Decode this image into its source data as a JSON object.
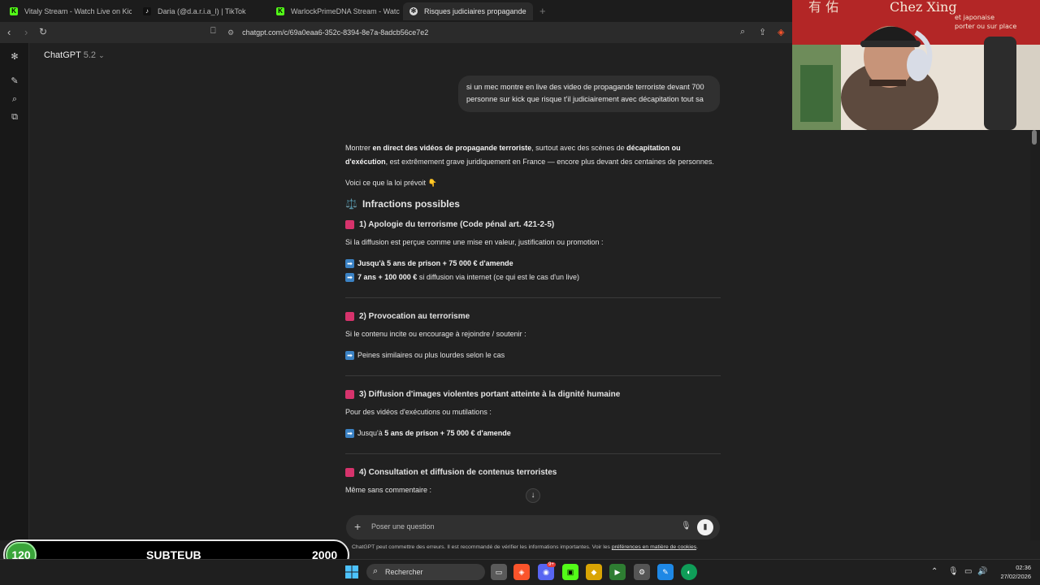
{
  "browser": {
    "tabs": [
      {
        "label": "Vitaly Stream - Watch Live on Kick",
        "favicon": "kick-icon",
        "active": false
      },
      {
        "label": "Daria (@d.a.r.i.a_l) | TikTok",
        "favicon": "tiktok-icon",
        "active": false
      },
      {
        "label": "WarlockPrimeDNA Stream - Watch Li",
        "favicon": "kick-icon",
        "active": false
      },
      {
        "label": "Risques judiciaires propagande",
        "favicon": "chatgpt-icon",
        "active": true
      }
    ],
    "url": "chatgpt.com/c/69a0eaa6-352c-8394-8e7a-8adcb56ce7e2"
  },
  "app": {
    "model_name": "ChatGPT",
    "model_version": "5.2"
  },
  "conversation": {
    "user_message": "si un mec montre en live des video de propagande terroriste devant 700 personne sur kick que risque t'il judiciairement avec décapitation tout sa",
    "intro": {
      "p1_a": "Montrer ",
      "p1_b": "en direct des vidéos de propagande terroriste",
      "p1_c": ", surtout avec des scènes de ",
      "p1_d": "décapitation ou d'exécution",
      "p1_e": ", est extrêmement grave juridiquement en France — encore plus devant des centaines de personnes.",
      "p2": "Voici ce que la loi prévoit 👇"
    },
    "heading": "Infractions possibles",
    "heading_emoji": "⚖️",
    "sections": {
      "s1": {
        "title": "1) Apologie du terrorisme (Code pénal art. 421-2-5)",
        "desc": "Si la diffusion est perçue comme une mise en valeur, justification ou promotion :",
        "line1": "Jusqu'à 5 ans de prison + 75 000 € d'amende",
        "line2_bold": "7 ans + 100 000 €",
        "line2_rest": " si diffusion via internet (ce qui est le cas d'un live)"
      },
      "s2": {
        "title": "2) Provocation au terrorisme",
        "desc": "Si le contenu incite ou encourage à rejoindre / soutenir :",
        "line1": "Peines similaires ou plus lourdes selon le cas"
      },
      "s3": {
        "title": "3) Diffusion d'images violentes portant atteinte à la dignité humaine",
        "desc": "Pour des vidéos d'exécutions ou mutilations :",
        "line1_a": "Jusqu'à ",
        "line1_b": "5 ans de prison + 75 000 € d'amende"
      },
      "s4": {
        "title": "4) Consultation et diffusion de contenus terroristes",
        "desc": "Même sans commentaire :"
      }
    }
  },
  "composer": {
    "placeholder": "Poser une question",
    "disclaimer_a": "ChatGPT peut commettre des erreurs. Il est recommandé de vérifier les informations importantes. Voir les ",
    "disclaimer_link": "préférences en matière de cookies",
    "disclaimer_end": "."
  },
  "overlay": {
    "count": "120",
    "label": "SUBTEUB",
    "goal": "2000"
  },
  "webcam": {
    "sign_text": "Chez Xing",
    "sign_sub1": "et japonaise",
    "sign_sub2": "porter ou sur place"
  },
  "taskbar": {
    "search_label": "Rechercher",
    "time": "02:36",
    "date": "27/02/2026",
    "badge": "9+"
  },
  "colors": {
    "background": "#212121",
    "bubble": "#303030",
    "accent_square": "#d6336c",
    "arrow_blue": "#3b82c4",
    "kick_green": "#53fc18"
  }
}
